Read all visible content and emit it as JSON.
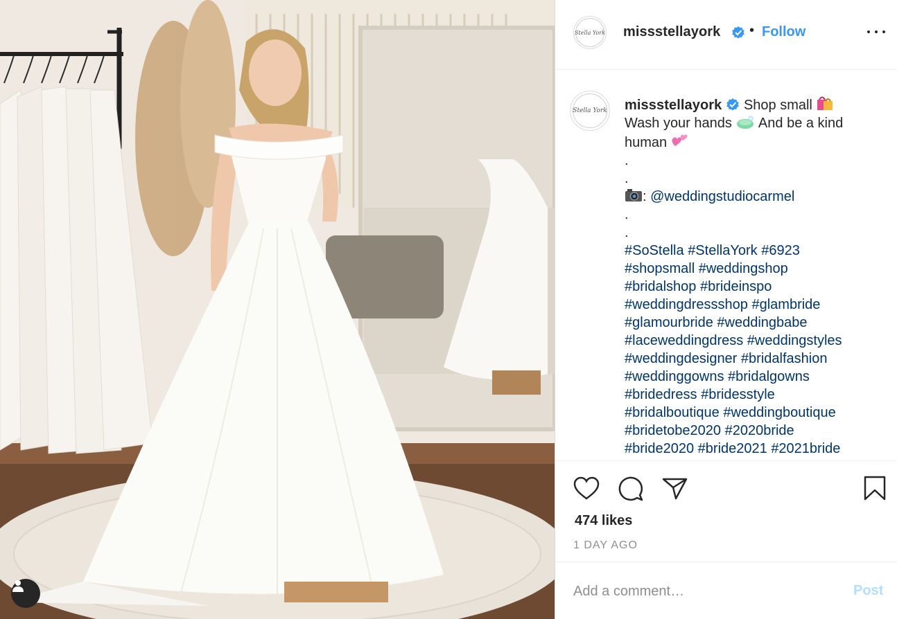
{
  "post": {
    "username": "missstellayork",
    "follow_label": "Follow",
    "separator": "•",
    "avatar_text": "Stella York",
    "caption": {
      "username": "missstellayork",
      "line1": "Shop small",
      "line1_emoji": "shopping-bags",
      "line2": "Wash your hands",
      "line2_emoji": "soap",
      "line2_tail": "And be a kind",
      "line3": "human",
      "line3_emoji": "two-hearts",
      "dot1": ".",
      "dot2": ".",
      "credit_emoji": "camera",
      "credit_colon": ":",
      "credit_handle": "@weddingstudiocarmel",
      "dot3": ".",
      "dot4": ".",
      "hashtag_lines": [
        "#SoStella #StellaYork #6923",
        "#shopsmall #weddingshop",
        "#bridalshop #brideinspo",
        "#weddingdressshop #glambride",
        "#glamourbride #weddingbabe",
        "#laceweddingdress #weddingstyles",
        "#weddingdesigner #bridalfashion",
        "#weddinggowns #bridalgowns",
        "#bridedress #bridesstyle",
        "#bridalboutique #weddingboutique",
        "#bridetobe2020 #2020bride",
        "#bride2020 #bride2021 #2021bride"
      ]
    },
    "likes": "474 likes",
    "time": "1 DAY AGO",
    "comment_placeholder": "Add a comment…",
    "post_label": "Post"
  },
  "colors": {
    "link": "#003569",
    "follow": "#3897f0",
    "verified": "#3897f0",
    "muted": "#8e8e8e",
    "post_disabled": "#b2dffc"
  },
  "icons": {
    "like": "heart-icon",
    "comment": "comment-bubble-icon",
    "share": "paper-plane-icon",
    "save": "bookmark-icon",
    "more": "more-options-icon",
    "tag": "user-tag-icon"
  }
}
